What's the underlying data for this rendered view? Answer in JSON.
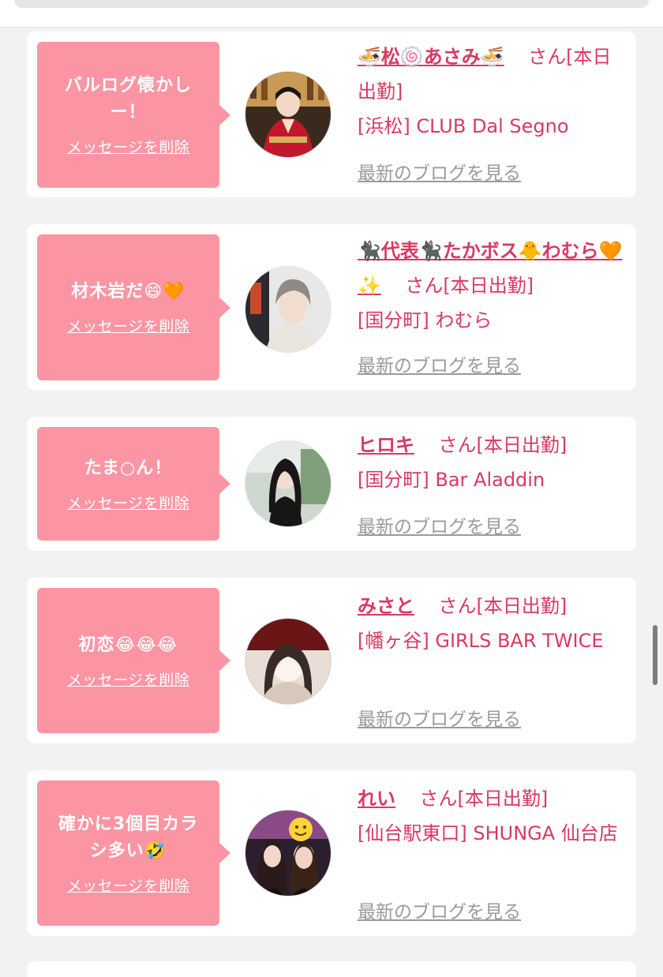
{
  "colors": {
    "accent": "#d83a61",
    "bubble": "#fc95a3",
    "muted_link": "#9a9a9a",
    "page_bg": "#f2f2f2"
  },
  "items": [
    {
      "message": "バルログ懐かしー！",
      "delete_label": "メッセージを削除",
      "name": "🍜松🍥あさみ🍜",
      "suffix": "さん[本日出勤]",
      "shop": "[浜松] CLUB Dal Segno",
      "blog_label": "最新のブログを見る",
      "avatar": "woman-in-red-kimono-at-bar"
    },
    {
      "message": "材木岩だ😄🧡",
      "delete_label": "メッセージを削除",
      "name": "🐈‍⬛代表🐈‍⬛たかボス🐥わむら🧡✨",
      "suffix": "さん[本日出勤]",
      "shop": "[国分町] わむら",
      "blog_label": "最新のブログを見る",
      "avatar": "woman-with-gray-hair"
    },
    {
      "message": "たま○ん！",
      "delete_label": "メッセージを削除",
      "name": "ヒロキ",
      "suffix": "さん[本日出勤]",
      "shop": "[国分町] Bar Aladdin",
      "blog_label": "最新のブログを見る",
      "avatar": "woman-long-dark-hair-outdoor"
    },
    {
      "message": "初恋😂😂😂",
      "delete_label": "メッセージを削除",
      "name": "みさと",
      "suffix": "さん[本日出勤]",
      "shop": "[幡ヶ谷] GIRLS BAR TWICE",
      "blog_label": "最新のブログを見る",
      "avatar": "woman-blurred-face"
    },
    {
      "message": "確かに3個目カラシ多い🤣",
      "delete_label": "メッセージを削除",
      "name": "れい",
      "suffix": "さん[本日出勤]",
      "shop": "[仙台駅東口] SHUNGA 仙台店",
      "blog_label": "最新のブログを見る",
      "avatar": "two-women-with-smiley-sticker"
    }
  ]
}
